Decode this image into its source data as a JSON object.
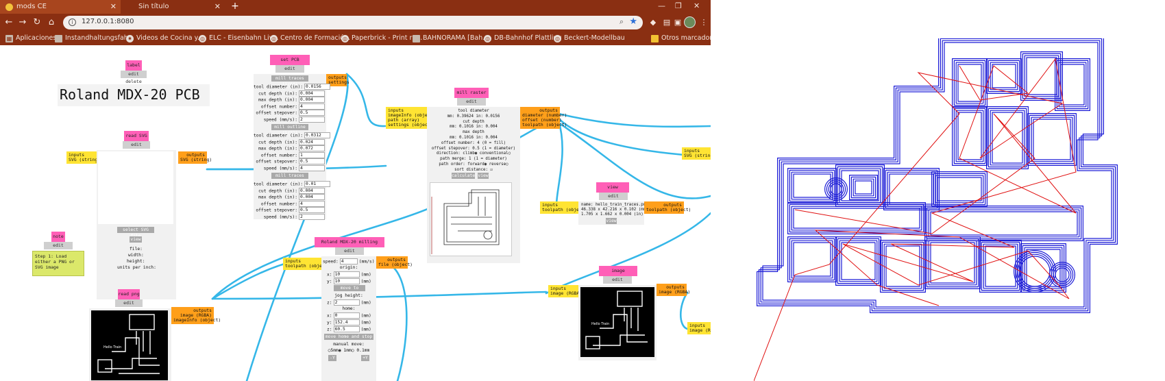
{
  "browser": {
    "tabs": [
      {
        "title": "mods CE",
        "active": true
      },
      {
        "title": "Sin título",
        "active": false
      }
    ],
    "address": "127.0.0.1:8080",
    "bookmarks": [
      "Aplicaciones",
      "Instandhaltungsfah...",
      "Videos de Cocina y...",
      "ELC - Eisenbahn Liv...",
      "Centro de Formació...",
      "Paperbrick - Print ra...",
      "BAHNORAMA [Bah...",
      "DB-Bahnhof Plattling",
      "Beckert-Modellbau",
      "Otros marcadores"
    ]
  },
  "common": {
    "edit_delete": "edit delete"
  },
  "modules": {
    "label": {
      "title": "label",
      "text": "Roland MDX-20 PCB"
    },
    "note": {
      "title": "note",
      "text": "Step 1: Load either a PNG or SVG image"
    },
    "read_svg": {
      "title": "read SVG",
      "input": "inputs\nSVG (string)",
      "output": "outputs\nSVG (string)",
      "select_btn": "select SVG file",
      "view_btn": "view",
      "info": [
        "file:",
        "width:",
        "height:",
        "units per inch:"
      ]
    },
    "read_png": {
      "title": "read png",
      "output": "outputs\nimage (RGBA)\nimageInfo (object)"
    },
    "pcb_defaults": {
      "title": "set PCB defaults",
      "output": "outputs\nsettings",
      "groups": [
        {
          "button": "mill traces (1/64)",
          "rows": [
            [
              "tool diameter (in):",
              "0.0156"
            ],
            [
              "cut depth (in):",
              "0.004"
            ],
            [
              "max depth (in):",
              "0.004"
            ],
            [
              "offset number:",
              "4"
            ],
            [
              "offset stepover:",
              "0.5"
            ],
            [
              "speed (mm/s):",
              "2"
            ]
          ]
        },
        {
          "button": "mill outline (1/32)",
          "rows": [
            [
              "tool diameter (in):",
              "0.0312"
            ],
            [
              "cut depth (in):",
              "0.024"
            ],
            [
              "max depth (in):",
              "0.072"
            ],
            [
              "offset number:",
              "1"
            ],
            [
              "offset stepover:",
              "0.5"
            ],
            [
              "speed (mm/s):",
              "4"
            ]
          ]
        },
        {
          "button": "mill traces (10 mil)",
          "rows": [
            [
              "tool diameter (in):",
              "0.01"
            ],
            [
              "cut depth (in):",
              "0.004"
            ],
            [
              "max depth (in):",
              "0.004"
            ],
            [
              "offset number:",
              "4"
            ],
            [
              "offset stepover:",
              "0.5"
            ],
            [
              "speed (mm/s):",
              "2"
            ]
          ]
        }
      ]
    },
    "mill_raster": {
      "title": "mill raster 2D",
      "input": "inputs\nimageInfo (object)\npath (array)\nsettings (object)",
      "output": "outputs\ndiameter (number)\noffset (number)\ntoolpath (object)",
      "lines": [
        "tool diameter",
        "mm: 0.39624 in: 0.0156",
        "cut depth",
        "mm: 0.1016  in: 0.004",
        "max depth",
        "mm: 0.1016  in: 0.004",
        "offset number: 4       (0 = fill)",
        "offset stepover: 0.5   (1 = diameter)",
        "direction: climb◉ conventional○",
        "path merge: 1          (1 = diameter)",
        "path order: forward◉ reverse○",
        "sort distance: ☑"
      ],
      "calculate_btn": "calculate",
      "view_btn": "view"
    },
    "view_toolpath": {
      "title": "view toolpath",
      "input": "inputs\ntoolpath (object)",
      "output": "outputs\ntoolpath (object)",
      "info": [
        "name: hello_train_traces.png",
        "46.338 x 42.216 x 0.102 (mm)",
        "1.705 x 1.662 x 0.004 (in)"
      ],
      "view_btn": "view"
    },
    "roland": {
      "title": "Roland MDX-20 milling machine",
      "input": "inputs\ntoolpath (object)",
      "output": "outputs\nfile (object)",
      "speed_label": "speed:",
      "speed_value": "4",
      "speed_unit": "(mm/s)",
      "origin_label": "origin:",
      "origin": [
        [
          "x:",
          "10",
          "(mm)"
        ],
        [
          "y:",
          "10",
          "(mm)"
        ]
      ],
      "move_origin_btn": "move to origin",
      "jog_label": "jog height:",
      "jog": [
        "z:",
        "2",
        "(mm)"
      ],
      "home_label": "home:",
      "home": [
        [
          "x:",
          "0",
          "(mm)"
        ],
        [
          "y:",
          "152.4",
          "(mm)"
        ],
        [
          "z:",
          "60.5",
          "(mm)"
        ]
      ],
      "move_home_btn": "move home and stop",
      "manual_label": "manual move:",
      "manual_opts": "○5mm◉ 1mm○ 0.1mm",
      "minus_btn": "-Y",
      "plus_btn": "+Y"
    },
    "threshold": {
      "title": "image threshold",
      "input": "inputs\nimage (RGBA)",
      "output": "outputs\nimage (RGBA)"
    },
    "edge_in_svg": "inputs\nSVG (string)",
    "edge_in_rgba": "inputs\nimage (RGBA"
  },
  "colors": {
    "title": "#ff5fb7",
    "input": "#ffe433",
    "output": "#ff9f1a",
    "wire": "#35b7e8",
    "trace": "#1a1ad6",
    "move": "#e01010"
  },
  "icons": [
    "mods-tab-icon",
    "back-icon",
    "forward-icon",
    "reload-icon",
    "home-icon",
    "info-icon",
    "zoom-icon",
    "star-icon",
    "extension-icon",
    "menu-icon"
  ]
}
